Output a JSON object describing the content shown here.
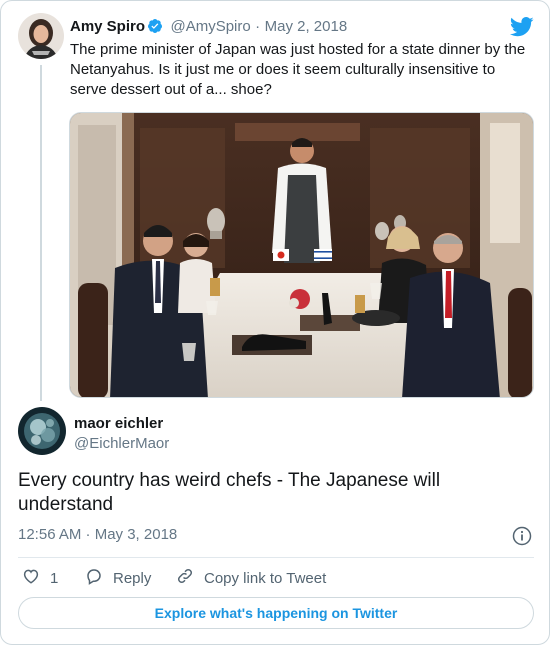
{
  "original": {
    "author_name": "Amy Spiro",
    "handle": "@AmySpiro",
    "date_separator": "·",
    "date": "May 2, 2018",
    "text": "The prime minister of Japan was just hosted for a state dinner by the Netanyahus. Is it just me or does it seem culturally insensitive to serve dessert out of a... shoe?",
    "verified": true
  },
  "reply": {
    "author_name": "maor eichler",
    "handle": "@EichlerMaor",
    "text": "Every country has weird chefs - The Japanese will understand",
    "time": "12:56 AM · May 3, 2018"
  },
  "actions": {
    "like_count": "1",
    "reply_label": "Reply",
    "copy_link_label": "Copy link to Tweet"
  },
  "footer": {
    "explore_label": "Explore what's happening on Twitter"
  },
  "colors": {
    "twitter_blue": "#1da1f2",
    "link_blue": "#1b95e0",
    "muted_text": "#657786",
    "border": "#cfd9de"
  },
  "icons": [
    "twitter-bird-icon",
    "verified-badge-icon",
    "info-icon",
    "heart-icon",
    "reply-icon",
    "link-icon"
  ]
}
